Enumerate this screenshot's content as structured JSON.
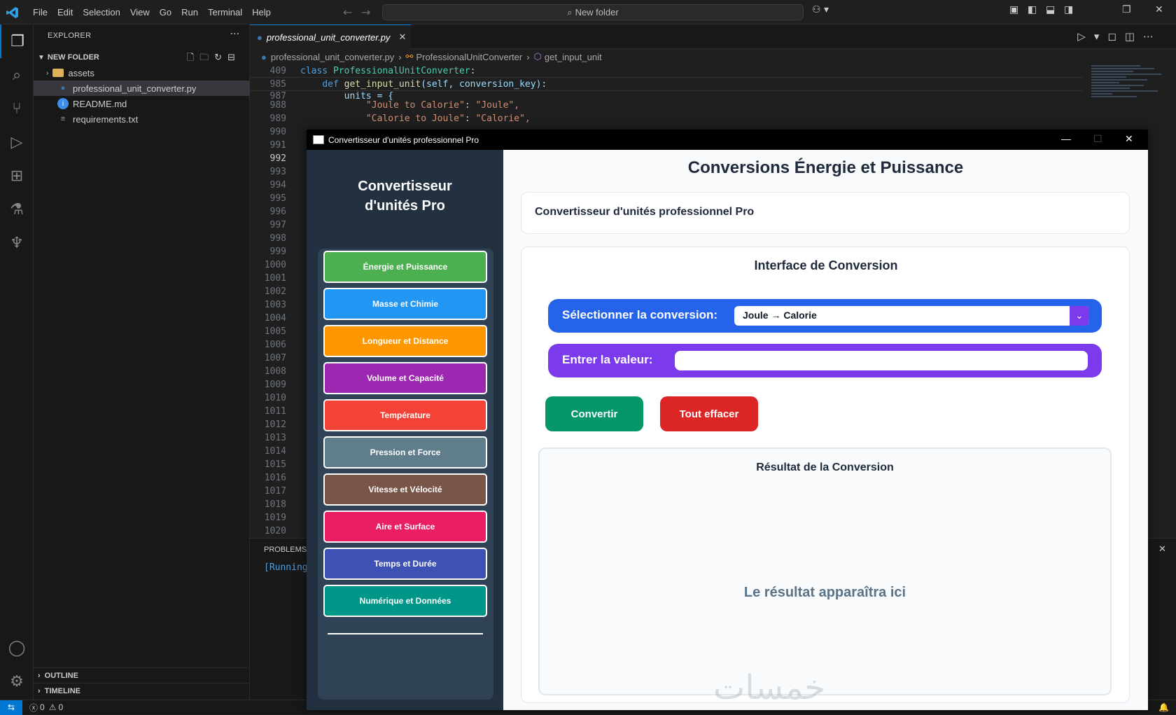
{
  "vscode": {
    "menu": [
      "File",
      "Edit",
      "Selection",
      "View",
      "Go",
      "Run",
      "Terminal",
      "Help"
    ],
    "search_text": "New folder",
    "explorer_title": "EXPLORER",
    "folder_name": "NEW FOLDER",
    "files": [
      {
        "name": "assets",
        "type": "folder"
      },
      {
        "name": "professional_unit_converter.py",
        "type": "python"
      },
      {
        "name": "README.md",
        "type": "info"
      },
      {
        "name": "requirements.txt",
        "type": "text"
      }
    ],
    "outline_label": "OUTLINE",
    "timeline_label": "TIMELINE",
    "tab_label": "professional_unit_converter.py",
    "breadcrumb": [
      "professional_unit_converter.py",
      "ProfessionalUnitConverter",
      "get_input_unit"
    ],
    "code": {
      "line_409": "409",
      "line_985": "985",
      "line_987": "987",
      "line_988": "988",
      "line_989": "989",
      "sticky_class_kw": "class",
      "sticky_class_name": "ProfessionalUnitConverter",
      "sticky_def_kw": "def",
      "sticky_def_name": "get_input_unit",
      "sticky_def_args": "(self, conversion_key):",
      "units_line": "units = {",
      "str_joule_to_calorie": "\"Joule to Calorie\"",
      "str_joule": "\"Joule\",",
      "str_calorie_to_joule": "\"Calorie to Joule\"",
      "str_calorie": "\"Calorie\","
    },
    "line_numbers": [
      "990",
      "991",
      "992",
      "993",
      "994",
      "995",
      "996",
      "997",
      "998",
      "999",
      "1000",
      "1001",
      "1002",
      "1003",
      "1004",
      "1005",
      "1006",
      "1007",
      "1008",
      "1009",
      "1010",
      "1011",
      "1012",
      "1013",
      "1014",
      "1015",
      "1016",
      "1017",
      "1018",
      "1019",
      "1020"
    ],
    "current_line": "992",
    "panel_tab": "PROBLEMS",
    "panel_output": "[Running",
    "status_errors": "0",
    "status_warnings": "0"
  },
  "app": {
    "window_title": "Convertisseur d'unités professionnel Pro",
    "brand": "Convertisseur d'unités Pro",
    "categories": [
      {
        "label": "Énergie et Puissance",
        "color": "#4caf50"
      },
      {
        "label": "Masse et Chimie",
        "color": "#2196f3"
      },
      {
        "label": "Longueur et Distance",
        "color": "#ff9800"
      },
      {
        "label": "Volume et Capacité",
        "color": "#9c27b0"
      },
      {
        "label": "Température",
        "color": "#f44336"
      },
      {
        "label": "Pression et Force",
        "color": "#607d8b"
      },
      {
        "label": "Vitesse et Vélocité",
        "color": "#795548"
      },
      {
        "label": "Aire et Surface",
        "color": "#e91e63"
      },
      {
        "label": "Temps et Durée",
        "color": "#3f51b5"
      },
      {
        "label": "Numérique et Données",
        "color": "#009688"
      }
    ],
    "heading": "Conversions Énergie et Puissance",
    "subtitle": "Convertisseur d'unités professionnel Pro",
    "interface_title": "Interface de Conversion",
    "select_label": "Sélectionner la conversion:",
    "select_value": "Joule → Calorie",
    "value_label": "Entrer la valeur:",
    "value_input": "",
    "convert_label": "Convertir",
    "clear_label": "Tout effacer",
    "result_title": "Résultat de la Conversion",
    "result_placeholder": "Le résultat apparaîtra ici",
    "watermark": "خمسات"
  }
}
